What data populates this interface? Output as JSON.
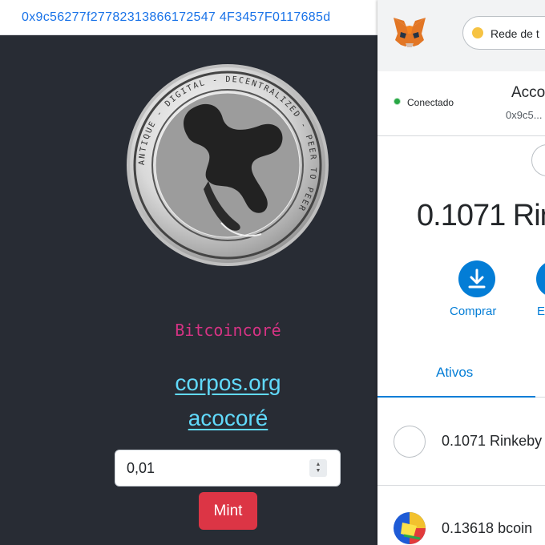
{
  "browser": {
    "address": "0x9c56277f27782313866172547 4F3457F0117685d"
  },
  "dapp": {
    "coin_inscription": "ANTIQUE - DIGITAL - DECENTRALIZED - PEER TO PEER",
    "brand": "Bitcoincoré",
    "link1": "corpos.org",
    "link2": "acocoré",
    "amount_value": "0,01",
    "mint_label": "Mint"
  },
  "metamask": {
    "network": "Rede de t",
    "connected": "Conectado",
    "account_name": "Acco",
    "account_address": "0x9c5...",
    "balance": "0.1071 Rin",
    "buy_label": "Comprar",
    "send_label": "E",
    "tab_assets": "Ativos",
    "assets": [
      {
        "label": "0.1071 Rinkeby"
      },
      {
        "label": "0.13618 bcoin"
      }
    ]
  },
  "colors": {
    "bg": "#282c34",
    "brand": "#d63384",
    "link": "#61dafb",
    "mint": "#dc3545",
    "mm_blue": "#037dd6"
  }
}
